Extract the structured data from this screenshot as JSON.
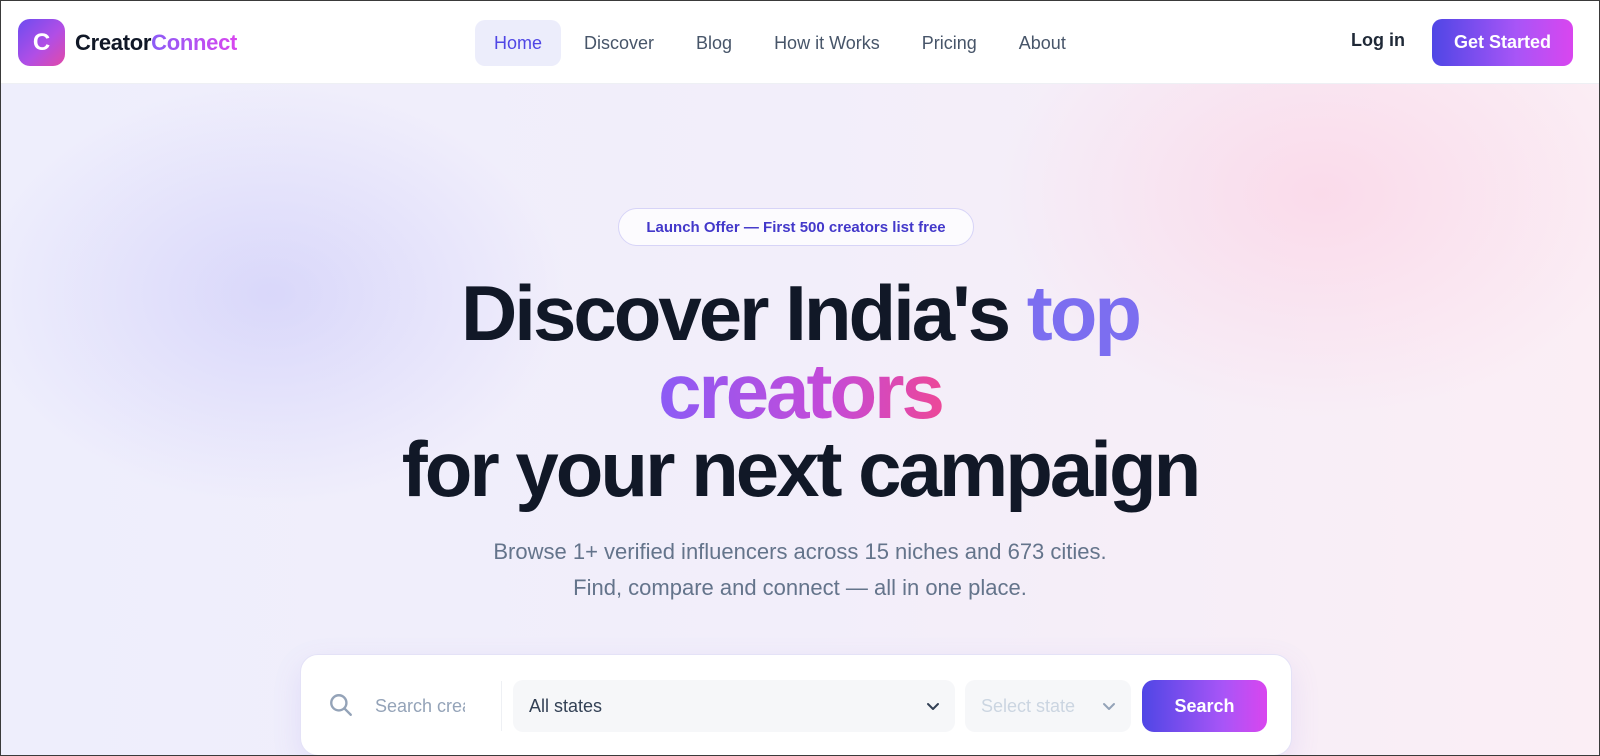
{
  "brand": {
    "logo_letter": "C",
    "name_part1": "Creator",
    "name_part2": "Connect"
  },
  "nav": {
    "items": [
      {
        "label": "Home",
        "active": true
      },
      {
        "label": "Discover"
      },
      {
        "label": "Blog"
      },
      {
        "label": "How it Works"
      },
      {
        "label": "Pricing"
      },
      {
        "label": "About"
      }
    ],
    "login_label": "Log in",
    "cta_label": "Get Started"
  },
  "hero": {
    "badge": "Launch Offer — First 500 creators list free",
    "headline_part1": "Discover India's ",
    "headline_part2": "top",
    "headline_part3": "creators",
    "headline_part4": "for your next campaign",
    "subtitle_line1": "Browse 1+ verified influencers across 15 niches and 673 cities.",
    "subtitle_line2": "Find, compare and connect — all in one place."
  },
  "search": {
    "placeholder": "Search creators",
    "state_value": "All states",
    "city_placeholder": "Select state",
    "button_label": "Search"
  },
  "colors": {
    "primary": "#4f46e5",
    "accent": "#d946ef",
    "text": "#111827",
    "muted": "#64748b"
  }
}
